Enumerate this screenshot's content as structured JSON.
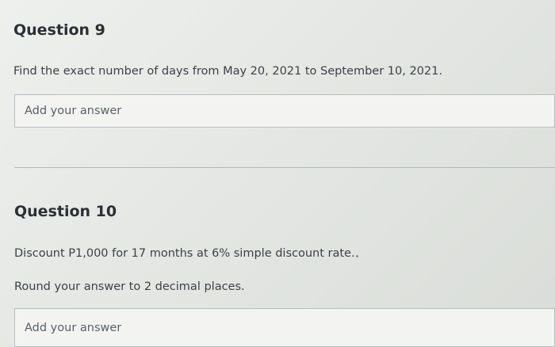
{
  "questions": [
    {
      "title": "Question 9",
      "lines": [
        "Find the exact number of days from May 20, 2021 to September 10, 2021."
      ],
      "answer_placeholder": "Add your answer"
    },
    {
      "title": "Question 10",
      "lines": [
        "Discount P1,000 for 17 months at 6% simple discount rate.",
        "Round your answer to 2 decimal places."
      ],
      "answer_placeholder": "Add your answer"
    }
  ]
}
